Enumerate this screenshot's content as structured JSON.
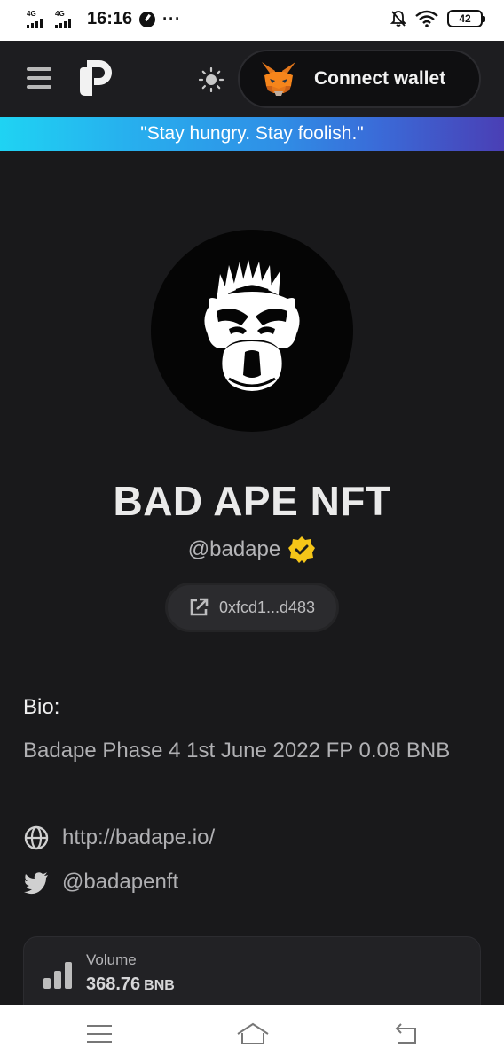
{
  "status_bar": {
    "sim1": "4G",
    "sim2": "4G",
    "time": "16:16",
    "overflow": "···",
    "battery": "42"
  },
  "header": {
    "menu_icon": "hamburger-icon",
    "logo_icon": "p-logo-icon",
    "theme_icon": "sun-icon",
    "wallet_icon": "metamask-fox-icon",
    "connect_label": "Connect wallet"
  },
  "banner": {
    "quote": "\"Stay hungry. Stay foolish.\"",
    "gradient": [
      "#1fd3f3",
      "#4a3fb5"
    ]
  },
  "profile": {
    "name": "BAD APE NFT",
    "handle": "@badape",
    "verified_color": "#f5c518",
    "address": "0xfcd1...d483"
  },
  "bio": {
    "title": "Bio:",
    "text": "Badape Phase 4 1st June 2022 FP 0.08 BNB",
    "website": "http://badape.io/",
    "twitter": "@badapenft"
  },
  "stats": {
    "volume_label": "Volume",
    "volume_value": "368.76",
    "volume_unit": "BNB"
  },
  "nav": {
    "recents_icon": "recents-icon",
    "home_icon": "home-icon",
    "back_icon": "back-icon"
  }
}
